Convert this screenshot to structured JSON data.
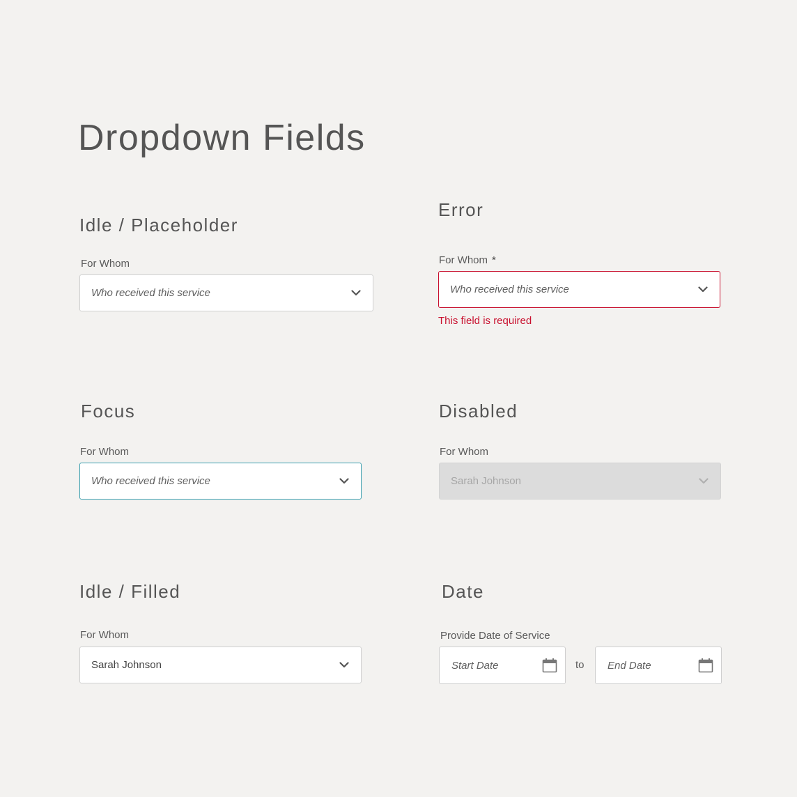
{
  "page": {
    "title": "Dropdown Fields"
  },
  "sections": {
    "idle_placeholder": {
      "title": "Idle / Placeholder",
      "label": "For Whom",
      "placeholder": "Who received this service"
    },
    "error": {
      "title": "Error",
      "label": "For Whom",
      "required_marker": "*",
      "placeholder": "Who received this service",
      "error_message": "This field is required",
      "color": "#c8102e"
    },
    "focus": {
      "title": "Focus",
      "label": "For Whom",
      "placeholder": "Who received this service",
      "color": "#3a9fae"
    },
    "disabled": {
      "title": "Disabled",
      "label": "For Whom",
      "value": "Sarah Johnson"
    },
    "idle_filled": {
      "title": "Idle / Filled",
      "label": "For Whom",
      "value": "Sarah Johnson"
    },
    "date": {
      "title": "Date",
      "label": "Provide Date of Service",
      "start_placeholder": "Start Date",
      "separator": "to",
      "end_placeholder": "End Date"
    }
  },
  "icons": {
    "dropdown": "chevron-down-icon",
    "date": "calendar-icon"
  }
}
